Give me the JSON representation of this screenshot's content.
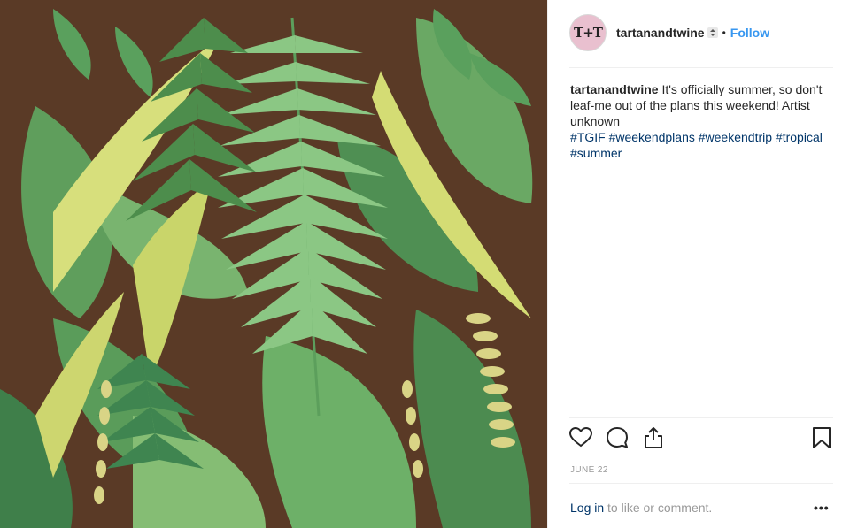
{
  "post": {
    "image": {
      "subject": "paper-cut tropical leaves collage",
      "colors": {
        "background": "#5a3a26",
        "leaf_dark": "#3f7f4a",
        "leaf_mid": "#6fae6a",
        "leaf_light": "#a8d08a",
        "leaf_yellow": "#d9e07a"
      }
    },
    "header": {
      "avatar_text": "T+T",
      "username": "tartanandtwine",
      "separator": "•",
      "follow_label": "Follow"
    },
    "caption": {
      "username": "tartanandtwine",
      "text": "It's officially summer, so don't leaf-me out of the plans this weekend! Artist unknown",
      "hashtags": [
        "#TGIF",
        "#weekendplans",
        "#weekendtrip",
        "#tropical",
        "#summer"
      ]
    },
    "actions": {
      "icons": [
        "heart-icon",
        "comment-icon",
        "share-icon",
        "bookmark-icon"
      ]
    },
    "date": "JUNE 22",
    "footer": {
      "login_link": "Log in",
      "login_suffix": " to like or comment.",
      "more_label": "•••"
    },
    "colors": {
      "link": "#3897f0",
      "hashtag": "#003569",
      "muted": "#999999",
      "text": "#262626"
    }
  }
}
